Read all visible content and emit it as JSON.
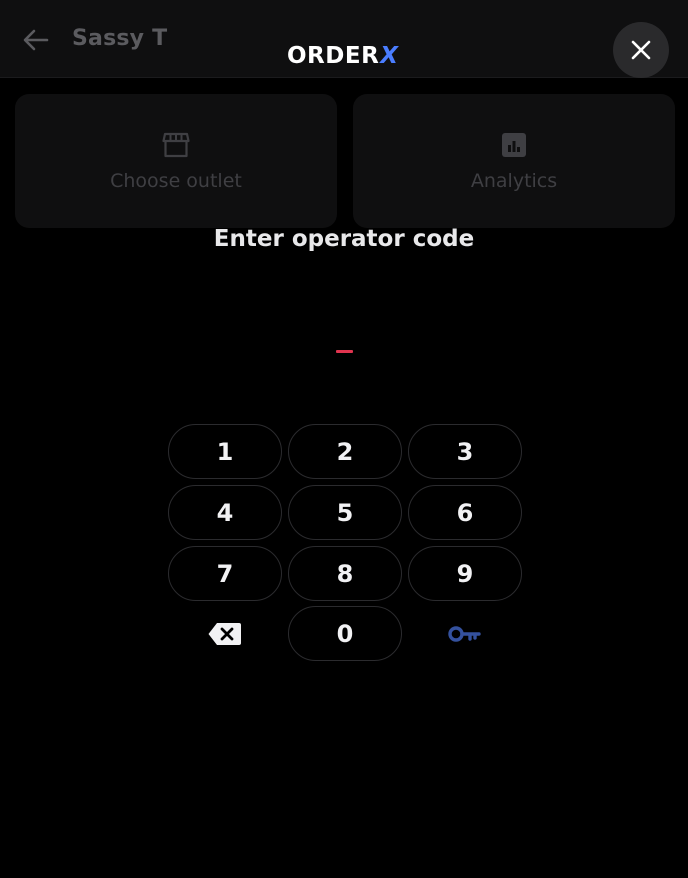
{
  "header": {
    "venue_name": "Sassy T",
    "brand_name": "ORDER",
    "brand_mark": "X",
    "back_icon": "arrow-left-icon",
    "close_icon": "close-icon"
  },
  "cards": [
    {
      "label": "Choose outlet",
      "icon": "storefront-icon"
    },
    {
      "label": "Analytics",
      "icon": "bar-chart-icon"
    }
  ],
  "pin_entry": {
    "prompt": "Enter operator code"
  },
  "keypad": {
    "keys": [
      "1",
      "2",
      "3",
      "4",
      "5",
      "6",
      "7",
      "8",
      "9",
      "0"
    ],
    "backspace_icon": "backspace-icon",
    "submit_icon": "key-icon"
  },
  "colors": {
    "background": "#000000",
    "accent_blue": "#4a7dff",
    "cursor_red": "#e0344f",
    "key_icon_blue": "#34519e"
  }
}
